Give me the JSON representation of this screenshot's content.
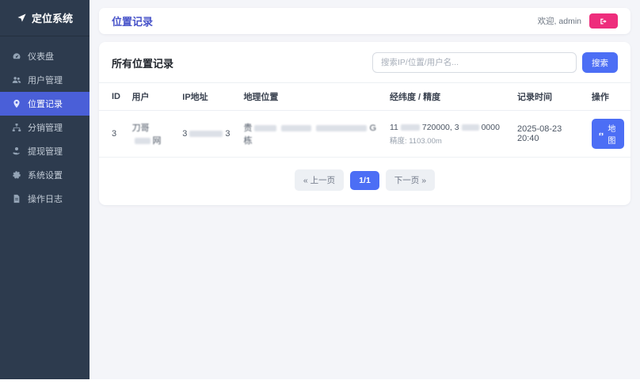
{
  "app": {
    "title": "定位系统"
  },
  "sidebar": {
    "items": [
      {
        "label": "仪表盘",
        "icon": "dashboard-icon",
        "active": false
      },
      {
        "label": "用户管理",
        "icon": "users-icon",
        "active": false
      },
      {
        "label": "位置记录",
        "icon": "map-marker-icon",
        "active": true
      },
      {
        "label": "分销管理",
        "icon": "sitemap-icon",
        "active": false
      },
      {
        "label": "提现管理",
        "icon": "withdraw-icon",
        "active": false
      },
      {
        "label": "系统设置",
        "icon": "settings-icon",
        "active": false
      },
      {
        "label": "操作日志",
        "icon": "log-icon",
        "active": false
      }
    ]
  },
  "header": {
    "title": "位置记录",
    "welcome": "欢迎, admin"
  },
  "panel": {
    "title": "所有位置记录",
    "search_placeholder": "搜索IP/位置/用户名...",
    "search_button": "搜索"
  },
  "table": {
    "columns": [
      "ID",
      "用户",
      "IP地址",
      "地理位置",
      "经纬度 / 精度",
      "记录时间",
      "操作"
    ],
    "row": {
      "id": "3",
      "user_start": "刀哥",
      "user_end": "网",
      "ip_start": "3",
      "ip_end": "3",
      "loc_start": "贵",
      "loc_end": "G栋",
      "coord_p1": "11",
      "coord_p2": "720000, 3",
      "coord_p3": "0000",
      "accuracy": "精度: 1103.00m",
      "time": "2025-08-23 20:40",
      "map_button": "地图"
    }
  },
  "pagination": {
    "prev": "« 上一页",
    "current": "1/1",
    "next": "下一页 »"
  },
  "icons": {
    "logo": "location-arrow",
    "logout": "sign-out",
    "row_action": "map"
  },
  "colors": {
    "accent": "#4c6ef5",
    "sidebar_bg": "#2d3b4e",
    "sidebar_active": "#4a5fd8",
    "title": "#4753c9",
    "logout_pink": "#ee2d7c",
    "main_bg": "#f4f5f9"
  }
}
